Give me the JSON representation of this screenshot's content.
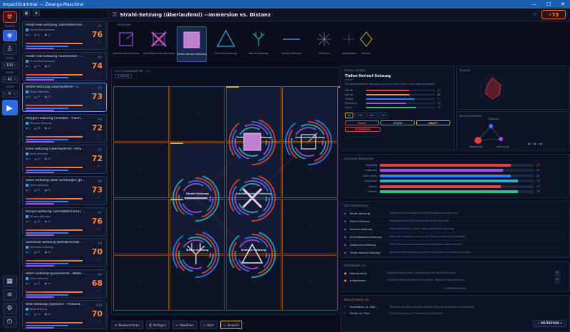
{
  "window": {
    "title": "ImpactGrammar — Zwangs-Maschine"
  },
  "rail": {
    "labels": [
      "MODUS",
      "TEMPO",
      "STUFE",
      "ZOOM"
    ],
    "tempo": "100",
    "level": "40",
    "zoom": "8"
  },
  "list": {
    "items": [
      {
        "title": "Punkt-Fokl-Setzung (überdetermin...",
        "sub": "Punkt-Fokl-Setzung",
        "score": "76",
        "level": "#1",
        "s": [
          "5",
          "37",
          "70"
        ]
      },
      {
        "title": "Punkt-Fokl-Setzung (aufsteend) -...",
        "sub": "Punkt-Fokl-Setzung",
        "score": "74",
        "level": "#2",
        "s": [
          "3",
          "23",
          "64"
        ]
      },
      {
        "title": "Strahl-Setzung (überlaufend) --I...",
        "sub": "Strahl-Setzung",
        "score": "73",
        "level": "#3",
        "s": [
          "8",
          "57",
          "73"
        ]
      },
      {
        "title": "Polygon-Setzung (instabil) --Fläch...",
        "sub": "Polygon-Setzung",
        "score": "72",
        "level": "#4",
        "s": [
          "3",
          "26",
          "59"
        ]
      },
      {
        "title": "Kreis-Setzung (überlaufend) --Rhy...",
        "sub": "Kreis-Setzung",
        "score": "72",
        "level": "#5",
        "s": [
          "6",
          "40",
          "60"
        ]
      },
      {
        "title": "Stern-Setzung (zum Schweigen ge...",
        "sub": "Stern-Setzung",
        "score": "73",
        "level": "#6",
        "s": [
          "4",
          "31",
          "61"
        ]
      },
      {
        "title": "Kurven-Setzung (verstößtlichend) ...",
        "sub": "Kurven-Setzung",
        "score": "76",
        "level": "#7",
        "s": [
          "5",
          "36",
          "64"
        ]
      },
      {
        "title": "Sechseck-Setzung (beflakneend) ...",
        "sub": "Sechseck-Setzung",
        "score": "70",
        "level": "#8",
        "s": [
          "3",
          "27",
          "59"
        ]
      },
      {
        "title": "Stern-Setzung (pulsierend) --Mate...",
        "sub": "Stern-Setzung",
        "score": "68",
        "level": "#9",
        "s": [
          "3",
          "22",
          "55"
        ]
      },
      {
        "title": "Blob-Setzung (zyklisch) --Präsenz ...",
        "sub": "Blob-Setzung",
        "score": "70",
        "level": "#10",
        "s": [
          "4",
          "33",
          "60"
        ]
      }
    ]
  },
  "header": {
    "title": "Strahl-Setzung (überlaufend) --Immersion vs. Distanz",
    "score": "⚡73"
  },
  "shapes": {
    "section": "SETZUNG",
    "items": [
      "Akzidenzle-Setzung",
      "Schrittwechsel-Setzung",
      "Tiefen-Verlauf-Setzung",
      "Dreieck-Setzung",
      "Baum-Setzung",
      "Strahl-Setzung",
      "Zentrum",
      "aufgeladen",
      "Rauten"
    ]
  },
  "grid": {
    "section": "SETZUNGSRASTER",
    "badge": "3×3",
    "sub": "4 ZEILEN",
    "cells": [
      "Tiefen-Verlauf-Setzung",
      "Ausbruchs-Setzung",
      "Strahl-Setzung",
      "Schrittwechsel-Setzung",
      "Baum-Setzung",
      "Dreieck-Setzung"
    ]
  },
  "actions": [
    "Neuberechnen",
    "Verfügen",
    "Abwählen",
    "Kern",
    "Bewertl"
  ],
  "detail": {
    "section": "FOKUS-DETAIL",
    "title": "Tiefen-Verlauf-Setzung",
    "sub": "Inside",
    "desc": "Ein kontinuierlicher Übergang von vorn nach hinten, hoch oben bis dunkel.",
    "metrics": [
      {
        "name": "Dichte",
        "v": "62"
      },
      {
        "name": "Impuls",
        "v": "64"
      },
      {
        "name": "Gefüge",
        "v": "71"
      },
      {
        "name": "Rhythmus",
        "v": "58"
      },
      {
        "name": "Druck",
        "v": "73"
      }
    ],
    "tabs": [
      "Ist",
      "Soll",
      "Neu",
      "Alt"
    ],
    "pills": [
      "IDEAL",
      "STARK",
      "SANFT",
      "EXTREMEN"
    ]
  },
  "radar": {
    "section": "RADAR"
  },
  "network": {
    "section": "BEZIEHUNGEN",
    "nodes": [
      "Ordnung",
      "Bewegung",
      "Spannung"
    ],
    "legend": "● 3 ● 2 ● 1"
  },
  "impulses": {
    "section": "ZUGKRAFTANALYSE",
    "items": [
      {
        "name": "Intensität",
        "v": "68"
      },
      {
        "name": "Leitender",
        "v": "64"
      },
      {
        "name": "Tiefe / Stark",
        "v": "68"
      },
      {
        "name": "Leuchtend",
        "v": "72"
      },
      {
        "name": "Impuls",
        "v": "63"
      },
      {
        "name": "Schärfe",
        "v": "72"
      }
    ]
  },
  "settings": {
    "section": "SETZUNGEN (6)",
    "items": [
      {
        "name": "Strahl-Setzung",
        "d": "Gerichtete Linie erzeugt eine klare Bewegung aus dem Feld."
      },
      {
        "name": "Baum-Setzung",
        "d": "Verzweigende Struktur wächst aus einem Ursprung."
      },
      {
        "name": "Dreieck-Setzung",
        "d": "Drei stabile Punkte, Dichte, Spitze, gerichtete Spannung."
      },
      {
        "name": "Schrittwechsel-Setzung",
        "d": "Kreuzung schneidet sich durch die Fläche in Form mit Schnittstelle."
      },
      {
        "name": "Ausbruchs-Setzung",
        "d": "Öffnet ein Ausbruchsmoment und erfolgt einen vollen Umbruch."
      },
      {
        "name": "Tiefen-Verlauf-Setzung",
        "d": "Kontinuierlicher Übergang von vorn nach hinten, hoch oben bis dunkel."
      }
    ]
  },
  "states": {
    "section": "ZUSTÄNDE (2)",
    "items": [
      {
        "name": "überlaufend",
        "d": "Kapazität überschritten, Setzung wird sich verbreitet zeigen."
      },
      {
        "name": "aufgeriesen",
        "d": "Frühlicher Wahnende Bruch der Symbole. Wieder für den Ausdruck."
      }
    ],
    "more": "▾ MINDERUNGEN"
  },
  "relations": {
    "section": "RELATIONEN (2)",
    "items": [
      {
        "name": "Immersion vs. Dist...",
        "d": "Zwischen der Nähe und dem Abstand, Fähe mit Raumbilder und Raumzeit."
      },
      {
        "name": "Strahl vs. Flan...",
        "d": "Ein Strahl gegen eine Flache beide Kräfte offen."
      }
    ],
    "mutation": "MUTATION"
  },
  "colors": {
    "accent": "#ff8a3a",
    "blue": "#3a7af0",
    "red": "#e0443a",
    "purple": "#a050e0",
    "teal": "#30b0c0",
    "green": "#30c080"
  }
}
